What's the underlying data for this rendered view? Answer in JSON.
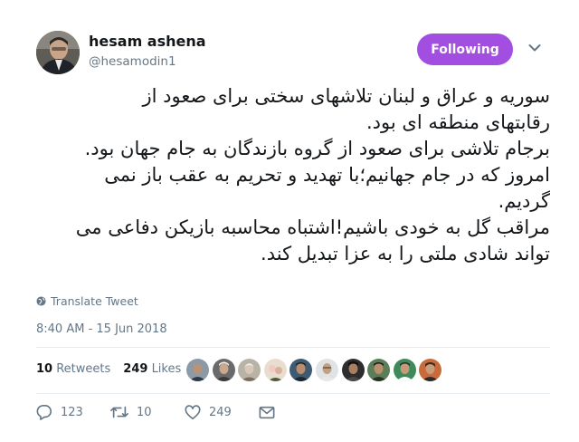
{
  "user": {
    "name": "hesam ashena",
    "handle": "@hesamodin1",
    "follow_label": "Following"
  },
  "tweet": {
    "lines": [
      "سوریه و عراق و لبنان تلاشهای سختی برای صعود از",
      "رقابتهای منطقه ای بود.",
      "برجام تلاشی برای صعود از گروه بازندگان به جام جهان بود.",
      "امروز که در جام جهانیم؛با تهدید و تحریم به عقب باز نمی",
      "گردیم.",
      "مراقب گل به خودی باشیم!اشتباه محاسبه بازیکن دفاعی می",
      "تواند شادی ملتی را به عزا  تبدیل کند."
    ],
    "translate_label": "Translate Tweet",
    "timestamp": "8:40 AM - 15 Jun 2018"
  },
  "stats": {
    "retweets_count": "10",
    "retweets_label": "Retweets",
    "likes_count": "249",
    "likes_label": "Likes"
  },
  "actions": {
    "reply_count": "123",
    "retweet_count": "10",
    "like_count": "249"
  },
  "colors": {
    "follow_button": "#a24ee0",
    "secondary_text": "#657786",
    "divider": "#e6ecf0"
  }
}
